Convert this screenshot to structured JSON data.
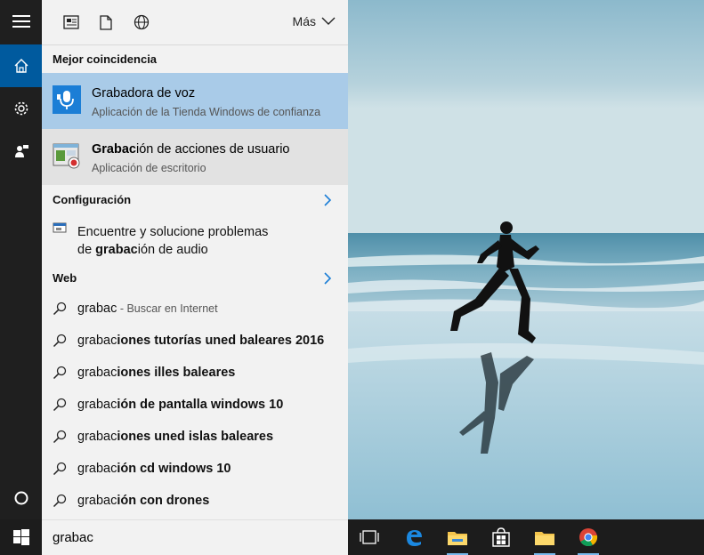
{
  "topbar": {
    "icons": [
      "news-icon",
      "document-icon",
      "web-globe-icon"
    ],
    "more_label": "Más"
  },
  "sections": {
    "best_match": "Mejor coincidencia",
    "settings": "Configuración",
    "web": "Web"
  },
  "best_matches": [
    {
      "title_bold": "",
      "title_rest": "Grabadora de voz",
      "subtitle": "Aplicación de la Tienda Windows de confianza",
      "icon": "voice-recorder-icon",
      "selected": true
    },
    {
      "title_bold": "Grabac",
      "title_rest": "ión de acciones de usuario",
      "subtitle": "Aplicación de escritorio",
      "icon": "steps-recorder-icon",
      "selected": false
    }
  ],
  "settings_item": {
    "line1": "Encuentre y solucione problemas",
    "line2_pre": "de ",
    "line2_bold": "grabac",
    "line2_post": "ión de audio",
    "icon": "troubleshoot-icon"
  },
  "web_results": [
    {
      "prefix": "grabac",
      "suffix": "",
      "hint": " - Buscar en Internet"
    },
    {
      "prefix": "grabac",
      "suffix": "iones tutorías uned baleares 2016",
      "hint": ""
    },
    {
      "prefix": "grabac",
      "suffix": "iones illes baleares",
      "hint": ""
    },
    {
      "prefix": "grabac",
      "suffix": "ión de pantalla windows 10",
      "hint": ""
    },
    {
      "prefix": "grabac",
      "suffix": "iones uned islas baleares",
      "hint": ""
    },
    {
      "prefix": "grabac",
      "suffix": "ión cd windows 10",
      "hint": ""
    },
    {
      "prefix": "grabac",
      "suffix": "ión con drones",
      "hint": ""
    }
  ],
  "search": {
    "value": "grabac"
  },
  "taskbar": {
    "icons": [
      "task-view-icon",
      "edge-icon",
      "file-explorer-icon",
      "store-icon",
      "file-explorer-icon",
      "chrome-icon"
    ]
  },
  "colors": {
    "accent": "#005a9e",
    "selected": "#a9cbe8",
    "hover": "#e2e2e2"
  }
}
